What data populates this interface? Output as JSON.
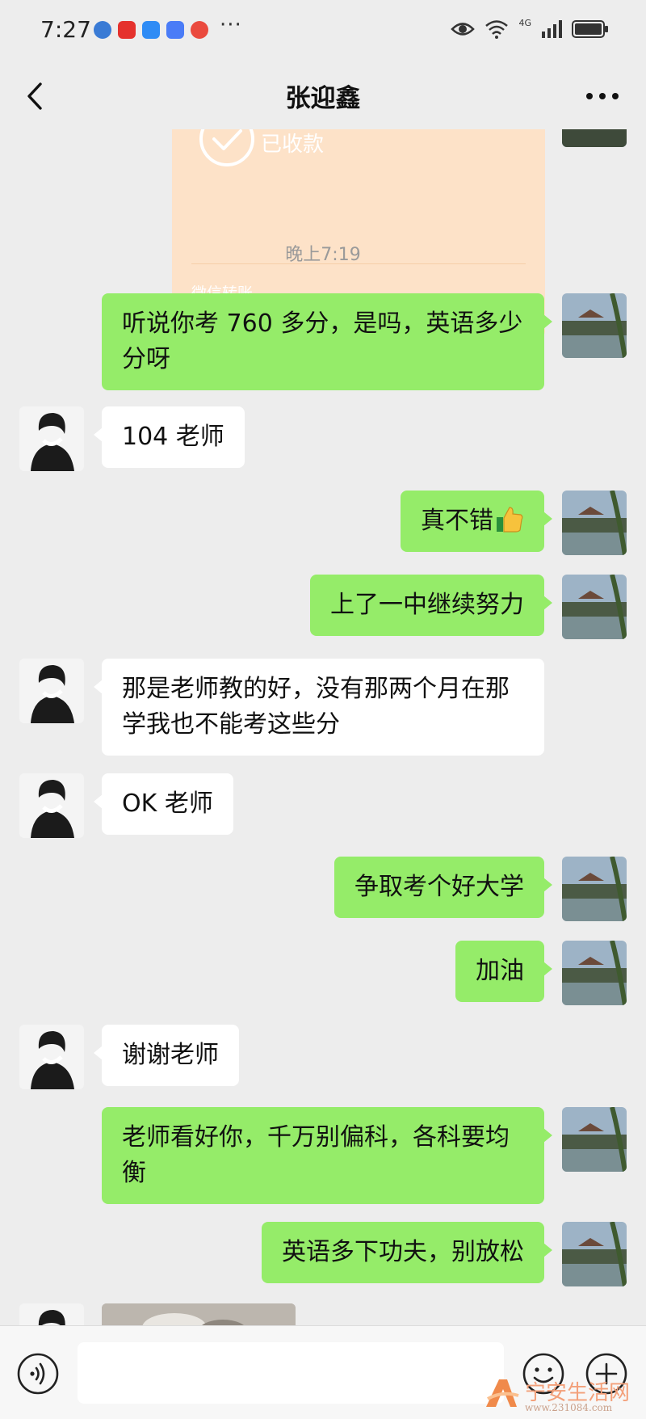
{
  "status_bar": {
    "time": "7:27",
    "more_glyph": "···",
    "network": "4G",
    "icons": [
      "maps-app-icon",
      "huawei-app-icon",
      "cloud-app-icon",
      "music-app-icon",
      "search-app-icon",
      "eye-icon",
      "wifi-icon",
      "signal-icon",
      "battery-icon"
    ]
  },
  "header": {
    "title": "张迎鑫"
  },
  "transfer_card": {
    "status": "已收款",
    "label": "微信转账",
    "background": "#fde2c8"
  },
  "time_separator": "晚上7:19",
  "messages": [
    {
      "side": "right",
      "text": "听说你考 760 多分，是吗，英语多少分呀"
    },
    {
      "side": "left",
      "text": "104 老师"
    },
    {
      "side": "right",
      "text": "真不错",
      "emoji": "thumbs-up"
    },
    {
      "side": "right",
      "text": "上了一中继续努力"
    },
    {
      "side": "left",
      "text": "那是老师教的好，没有那两个月在那学我也不能考这些分"
    },
    {
      "side": "left",
      "text": "OK 老师"
    },
    {
      "side": "right",
      "text": "争取考个好大学"
    },
    {
      "side": "right",
      "text": "加油"
    },
    {
      "side": "left",
      "text": "谢谢老师"
    },
    {
      "side": "right",
      "text": "老师看好你，千万别偏科，各科要均衡"
    },
    {
      "side": "right",
      "text": "英语多下功夫，别放松"
    }
  ],
  "watermark": {
    "name": "宁安生活网",
    "url": "www.231084.com"
  },
  "colors": {
    "background": "#ededed",
    "sent_bubble": "#95ec69",
    "received_bubble": "#ffffff"
  }
}
